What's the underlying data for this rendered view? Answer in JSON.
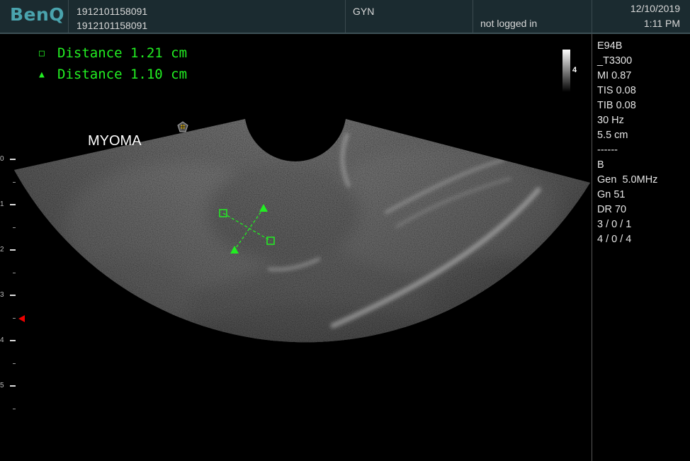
{
  "header": {
    "logo": "BenQ",
    "patient_id": "1912101158091",
    "patient_name": "1912101158091",
    "exam_preset": "GYN",
    "login_status": "not logged in",
    "date": "12/10/2019",
    "time": "1:11 PM"
  },
  "measurements": [
    {
      "symbol": "square",
      "text": "Distance 1.21 cm"
    },
    {
      "symbol": "triangle",
      "text": "Distance 1.10 cm"
    }
  ],
  "annotation": "MYOMA",
  "gray_map_label": "4",
  "info_panel": [
    "E94B",
    "_T3300",
    "MI 0.87",
    "TIS 0.08",
    "TIB 0.08",
    "30 Hz",
    "5.5 cm",
    "------",
    "B",
    "Gen  5.0MHz",
    "Gn 51",
    "DR 70",
    "3 / 0 / 1",
    "4 / 0 / 4"
  ],
  "depth_scale": [
    "0",
    "1",
    "2",
    "3",
    "4",
    "5"
  ],
  "colors": {
    "header_bg": "#1b2b30",
    "logo": "#4aa3ad",
    "measurement": "#22ee22",
    "focus_marker": "#e00000"
  }
}
